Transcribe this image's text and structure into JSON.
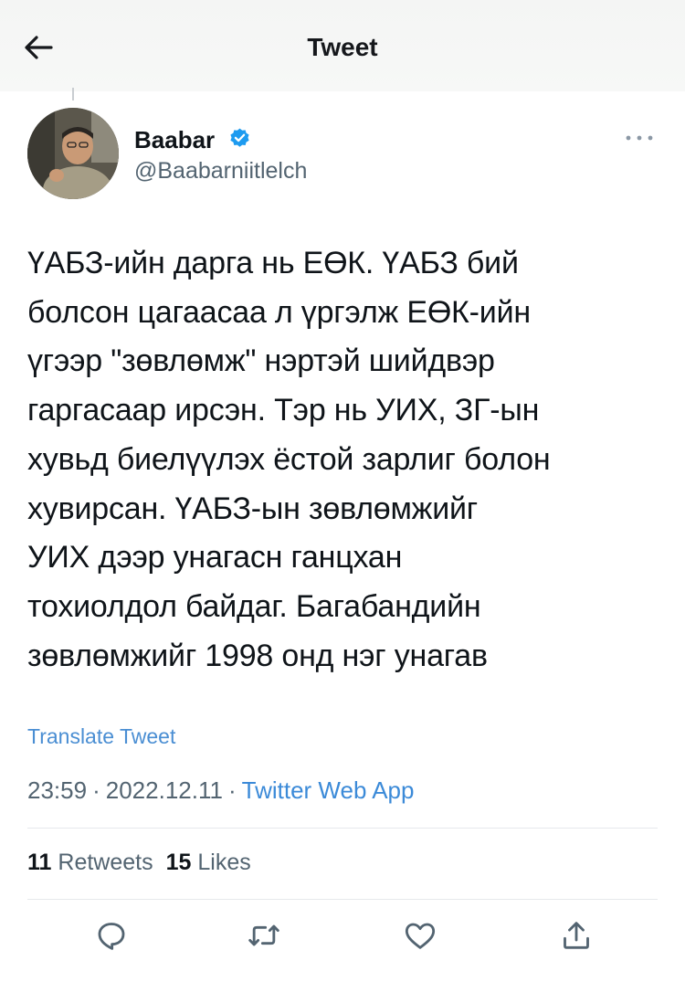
{
  "header": {
    "title": "Tweet",
    "back_icon": "arrow-left-icon"
  },
  "author": {
    "name": "Baabar",
    "handle": "@Baabarniitlelch",
    "verified": true,
    "badge_color": "#1d9bf0"
  },
  "tweet": {
    "text": "ҮАБЗ-ийн дарга нь ЕӨК. ҮАБЗ бий\nболсон цагаасаа л үргэлж ЕӨК-ийн\nүгээр \"зөвлөмж\" нэртэй шийдвэр\nгаргасаар ирсэн. Тэр нь УИХ, ЗГ-ын\nхувьд биелүүлэх ёстой зарлиг болон\nхувирсан. ҮАБЗ-ын зөвлөмжийг\nУИХ дээр унагасн ганцхан\nтохиолдол байдаг. Багабандийн\nзөвлөмжийг 1998 онд нэг унагав",
    "translate_label": "Translate Tweet"
  },
  "meta": {
    "time": "23:59",
    "date": "2022.12.11",
    "separator": "·",
    "source": "Twitter Web App"
  },
  "stats": {
    "retweets_count": "11",
    "retweets_label": "Retweets",
    "likes_count": "15",
    "likes_label": "Likes"
  },
  "actions": [
    "reply-icon",
    "retweet-icon",
    "like-icon",
    "share-icon"
  ],
  "colors": {
    "link": "#4a8ed3",
    "secondary_text": "#536471",
    "icon": "#536471"
  }
}
